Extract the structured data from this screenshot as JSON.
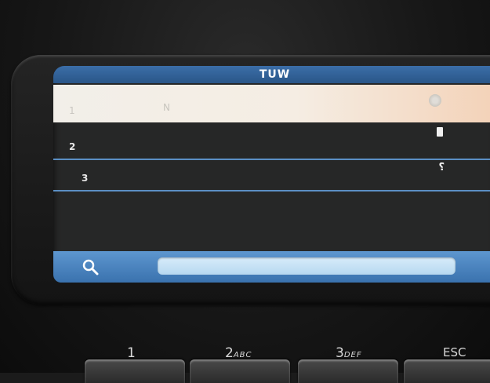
{
  "screen": {
    "title": "TUW",
    "rows": [
      {
        "number": "1",
        "name": "N",
        "icon": "fingerprint-icon"
      },
      {
        "number": "2",
        "name": "",
        "icon": "card-icon"
      },
      {
        "number": "3",
        "name": "",
        "icon": "key-icon"
      }
    ],
    "search": {
      "value": "",
      "placeholder": ""
    }
  },
  "keypad": {
    "key1": {
      "digit": "1",
      "sub": ""
    },
    "key2": {
      "digit": "2",
      "sub": "ABC"
    },
    "key3": {
      "digit": "3",
      "sub": "DEF"
    },
    "esc": {
      "label": "ESC"
    }
  },
  "colors": {
    "title_bar": "#3b6ea8",
    "search_bar": "#4a84c0",
    "row_divider": "#5b8fc4",
    "selected_row": "#f2efe9"
  }
}
